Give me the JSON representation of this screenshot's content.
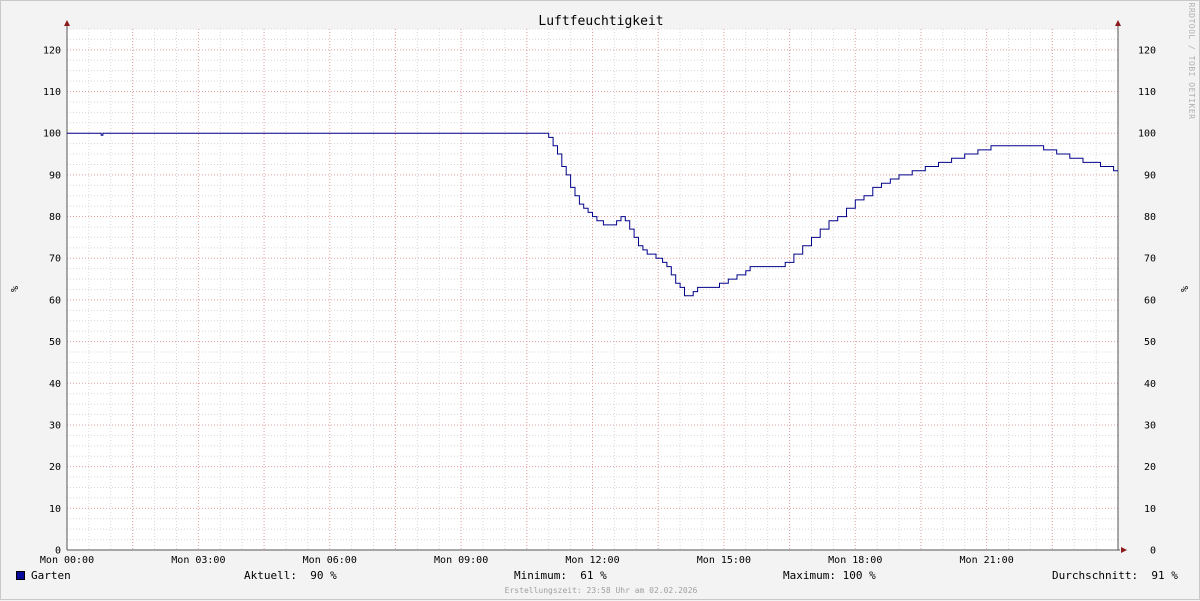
{
  "chart_data": {
    "type": "line",
    "title": "Luftfeuchtigkeit",
    "ylabel": "%",
    "xlabel": "",
    "ylim": [
      0,
      125
    ],
    "xlim_hours": [
      0,
      24
    ],
    "y_ticks": [
      0,
      10,
      20,
      30,
      40,
      50,
      60,
      70,
      80,
      90,
      100,
      110,
      120
    ],
    "x_ticks": [
      {
        "hour": 0,
        "label": "Mon 00:00"
      },
      {
        "hour": 3,
        "label": "Mon 03:00"
      },
      {
        "hour": 6,
        "label": "Mon 06:00"
      },
      {
        "hour": 9,
        "label": "Mon 09:00"
      },
      {
        "hour": 12,
        "label": "Mon 12:00"
      },
      {
        "hour": 15,
        "label": "Mon 15:00"
      },
      {
        "hour": 18,
        "label": "Mon 18:00"
      },
      {
        "hour": 21,
        "label": "Mon 21:00"
      }
    ],
    "grid": true,
    "series": [
      {
        "name": "Garten",
        "color": "#00008b",
        "points": [
          [
            0.0,
            100
          ],
          [
            0.75,
            100
          ],
          [
            0.78,
            99.5
          ],
          [
            0.82,
            100
          ],
          [
            10.9,
            100
          ],
          [
            11.0,
            99
          ],
          [
            11.1,
            97
          ],
          [
            11.2,
            95
          ],
          [
            11.3,
            92
          ],
          [
            11.4,
            90
          ],
          [
            11.5,
            87
          ],
          [
            11.6,
            85
          ],
          [
            11.7,
            83
          ],
          [
            11.8,
            82
          ],
          [
            11.9,
            81
          ],
          [
            12.0,
            80
          ],
          [
            12.1,
            79
          ],
          [
            12.25,
            78
          ],
          [
            12.45,
            78
          ],
          [
            12.55,
            79
          ],
          [
            12.65,
            80
          ],
          [
            12.75,
            79
          ],
          [
            12.85,
            77
          ],
          [
            12.95,
            75
          ],
          [
            13.05,
            73
          ],
          [
            13.15,
            72
          ],
          [
            13.25,
            71
          ],
          [
            13.45,
            70
          ],
          [
            13.6,
            69
          ],
          [
            13.7,
            68
          ],
          [
            13.8,
            66
          ],
          [
            13.9,
            64
          ],
          [
            14.0,
            63
          ],
          [
            14.1,
            61
          ],
          [
            14.2,
            61
          ],
          [
            14.3,
            62
          ],
          [
            14.4,
            63
          ],
          [
            14.8,
            63
          ],
          [
            14.9,
            64
          ],
          [
            15.1,
            65
          ],
          [
            15.3,
            66
          ],
          [
            15.5,
            67
          ],
          [
            15.6,
            68
          ],
          [
            16.3,
            68
          ],
          [
            16.4,
            69
          ],
          [
            16.6,
            71
          ],
          [
            16.8,
            73
          ],
          [
            17.0,
            75
          ],
          [
            17.2,
            77
          ],
          [
            17.4,
            79
          ],
          [
            17.6,
            80
          ],
          [
            17.8,
            82
          ],
          [
            18.0,
            84
          ],
          [
            18.2,
            85
          ],
          [
            18.4,
            87
          ],
          [
            18.6,
            88
          ],
          [
            18.8,
            89
          ],
          [
            19.0,
            90
          ],
          [
            19.3,
            91
          ],
          [
            19.6,
            92
          ],
          [
            19.9,
            93
          ],
          [
            20.2,
            94
          ],
          [
            20.5,
            95
          ],
          [
            20.8,
            96
          ],
          [
            21.1,
            97
          ],
          [
            21.6,
            97
          ],
          [
            22.2,
            97
          ],
          [
            22.3,
            96
          ],
          [
            22.6,
            95
          ],
          [
            22.9,
            94
          ],
          [
            23.2,
            93
          ],
          [
            23.6,
            92
          ],
          [
            23.9,
            91
          ],
          [
            24.3,
            90
          ]
        ]
      }
    ]
  },
  "legend": {
    "series_name": "Garten",
    "current": "Aktuell:  90 %",
    "minimum": "Minimum:  61 %",
    "maximum": "Maximum: 100 %",
    "average": "Durchschnitt:  91 %"
  },
  "watermark": "RRDTOOL / TOBI OETIKER",
  "footer": "Erstellungszeit: 23:58 Uhr am 02.02.2026"
}
